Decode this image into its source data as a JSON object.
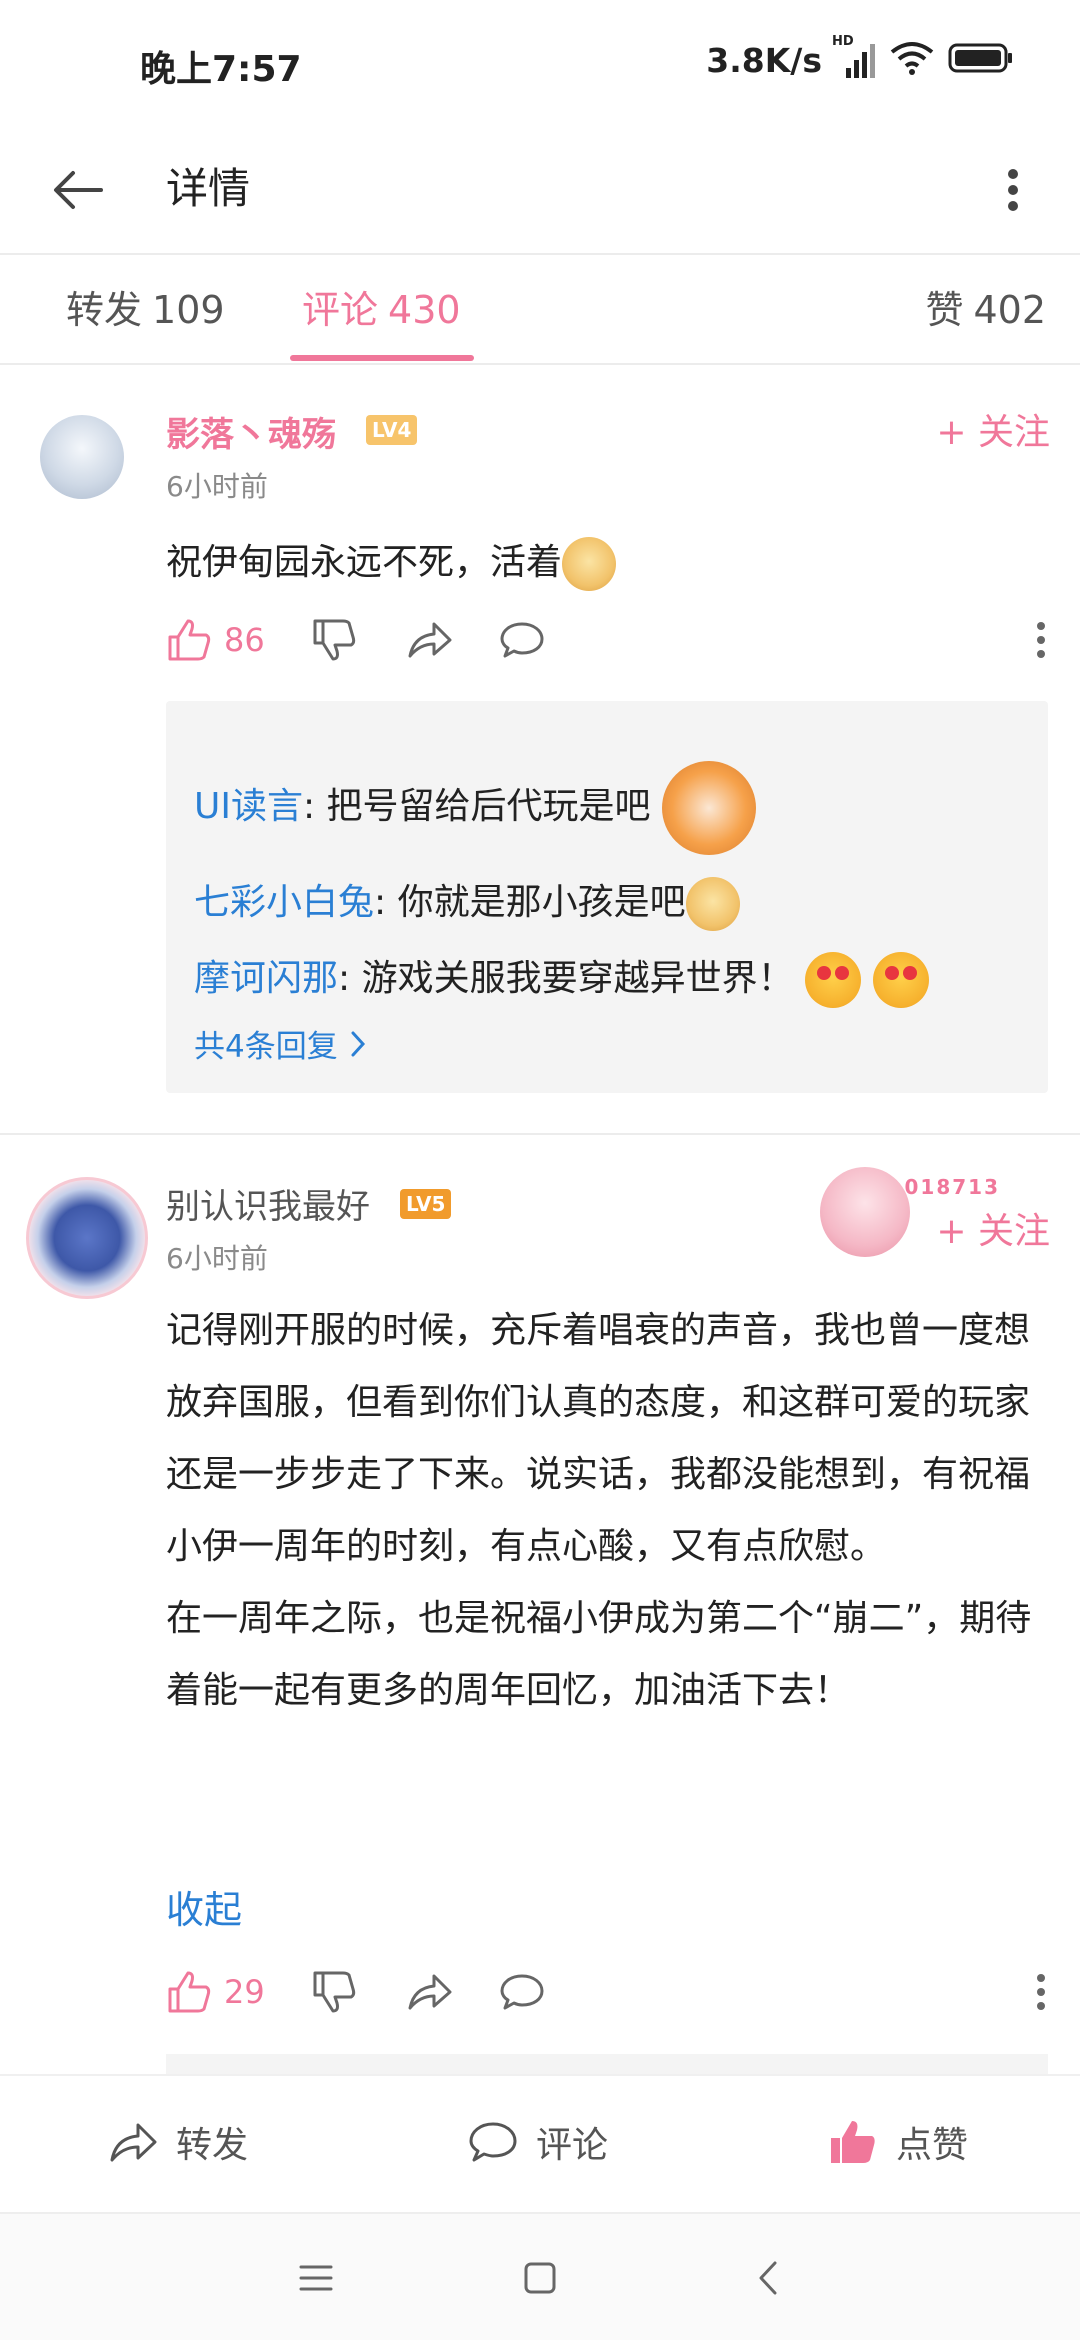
{
  "status_bar": {
    "time": "晚上7:57",
    "net_speed": "3.8K/s",
    "hd": "HD",
    "icons": [
      "signal-icon",
      "wifi-icon",
      "battery-icon"
    ]
  },
  "header": {
    "title": "详情"
  },
  "tabs": {
    "repost_label": "转发",
    "repost_count": "109",
    "comment_label": "评论",
    "comment_count": "430",
    "like_label": "赞",
    "like_count": "402",
    "active": "comment"
  },
  "comments": [
    {
      "user": "影落丶魂殇",
      "level": "LV4",
      "time": "6小时前",
      "follow": "+ 关注",
      "text": "祝伊甸园永远不死，活着",
      "likes": "86",
      "replies": [
        {
          "name": "UI读言",
          "text": ": 把号留给后代玩是吧"
        },
        {
          "name": "七彩小白兔",
          "text": ": 你就是那小孩是吧"
        },
        {
          "name": "摩诃闪那",
          "text": ": 游戏关服我要穿越异世界！"
        }
      ],
      "more_replies": "共4条回复"
    },
    {
      "user": "别认识我最好",
      "level": "LV5",
      "time": "6小时前",
      "follow": "+ 关注",
      "fan_number": "018713",
      "text": "记得刚开服的时候，充斥着唱衰的声音，我也曾一度想放弃国服，但看到你们认真的态度，和这群可爱的玩家还是一步步走了下来。说实话，我都没能想到，有祝福小伊一周年的时刻，有点心酸，又有点欣慰。\n在一周年之际，也是祝福小伊成为第二个“崩二”，期待着能一起有更多的周年回忆，加油活下去！",
      "collapse": "收起",
      "likes": "29"
    }
  ],
  "bottom_bar": {
    "repost": "转发",
    "comment": "评论",
    "like": "点赞"
  },
  "colors": {
    "accent": "#f0779a",
    "link": "#2a7fd4"
  }
}
